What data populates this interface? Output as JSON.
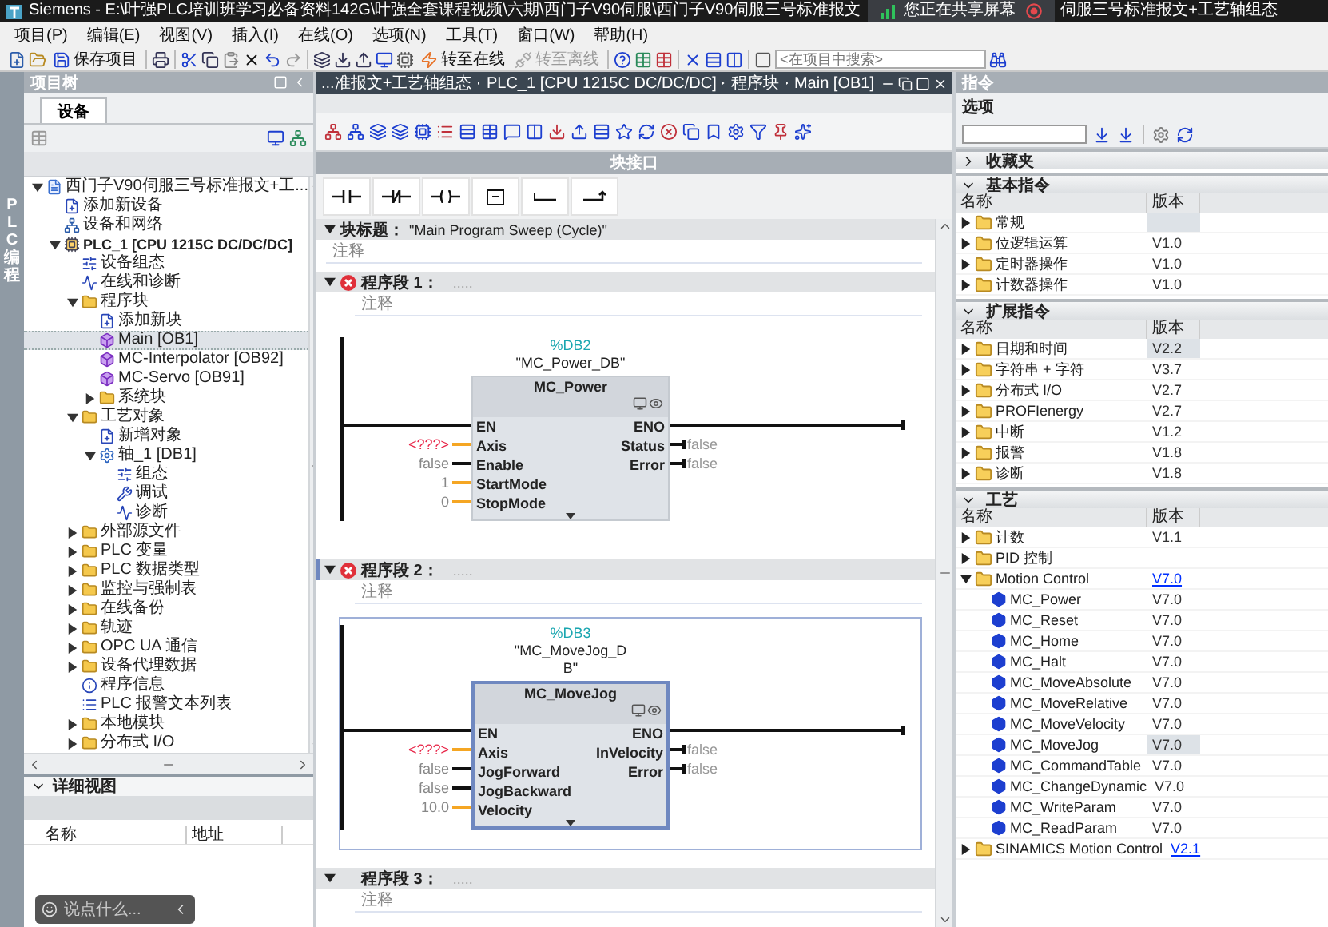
{
  "title_bar": {
    "title": "Siemens  -  E:\\叶强PLC培训班学习必备资料142G\\叶强全套课程视频\\六期\\西门子V90伺服\\西门子V90伺服三号标准报文",
    "sharing": "您正在共享屏幕",
    "title_tail": "伺服三号标准报文+工艺轴组态"
  },
  "menu": [
    "项目(P)",
    "编辑(E)",
    "视图(V)",
    "插入(I)",
    "在线(O)",
    "选项(N)",
    "工具(T)",
    "窗口(W)",
    "帮助(H)"
  ],
  "toolbar": {
    "save": "保存项目",
    "go_online": {
      "label": "转至在线",
      "disabled": false
    },
    "go_offline": {
      "label": "转至离线",
      "disabled": true
    },
    "search": {
      "placeholder": "<在项目中搜索>"
    }
  },
  "side_tab": "PLC 编程",
  "project_tree": {
    "title": "项目树",
    "tabs": [
      {
        "label": "设备",
        "selected": true
      }
    ],
    "items": [
      {
        "label": "西门子V90伺服三号标准报文+工...",
        "kind": "project",
        "expanded": true,
        "selected": false,
        "children": [
          {
            "label": "添加新设备",
            "kind": "add",
            "selected": false
          },
          {
            "label": "设备和网络",
            "kind": "network",
            "selected": false
          },
          {
            "label": "PLC_1 [CPU 1215C DC/DC/DC]",
            "kind": "plc",
            "expanded": true,
            "selected": false,
            "children": [
              {
                "label": "设备组态",
                "kind": "config",
                "selected": false
              },
              {
                "label": "在线和诊断",
                "kind": "diag",
                "selected": false
              },
              {
                "label": "程序块",
                "kind": "folder",
                "expanded": true,
                "selected": false,
                "children": [
                  {
                    "label": "添加新块",
                    "kind": "add",
                    "selected": false
                  },
                  {
                    "label": "Main [OB1]",
                    "kind": "block",
                    "selected": true
                  },
                  {
                    "label": "MC-Interpolator [OB92]",
                    "kind": "block",
                    "selected": false
                  },
                  {
                    "label": "MC-Servo [OB91]",
                    "kind": "block",
                    "selected": false
                  },
                  {
                    "label": "系统块",
                    "kind": "folder",
                    "expanded": false,
                    "selected": false
                  }
                ]
              },
              {
                "label": "工艺对象",
                "kind": "folder",
                "expanded": true,
                "selected": false,
                "children": [
                  {
                    "label": "新增对象",
                    "kind": "add",
                    "selected": false
                  },
                  {
                    "label": "轴_1 [DB1]",
                    "kind": "axis",
                    "expanded": true,
                    "selected": false,
                    "children": [
                      {
                        "label": "组态",
                        "kind": "config",
                        "selected": false
                      },
                      {
                        "label": "调试",
                        "kind": "tool",
                        "selected": false
                      },
                      {
                        "label": "诊断",
                        "kind": "diag",
                        "selected": false
                      }
                    ]
                  }
                ]
              },
              {
                "label": "外部源文件",
                "kind": "folder",
                "expanded": false,
                "selected": false
              },
              {
                "label": "PLC 变量",
                "kind": "folder",
                "expanded": false,
                "selected": false
              },
              {
                "label": "PLC 数据类型",
                "kind": "folder",
                "expanded": false,
                "selected": false
              },
              {
                "label": "监控与强制表",
                "kind": "folder",
                "expanded": false,
                "selected": false
              },
              {
                "label": "在线备份",
                "kind": "folder",
                "expanded": false,
                "selected": false
              },
              {
                "label": "轨迹",
                "kind": "folder",
                "expanded": false,
                "selected": false
              },
              {
                "label": "OPC UA 通信",
                "kind": "folder",
                "expanded": false,
                "selected": false
              },
              {
                "label": "设备代理数据",
                "kind": "folder",
                "expanded": false,
                "selected": false
              },
              {
                "label": "程序信息",
                "kind": "info",
                "selected": false
              },
              {
                "label": "PLC 报警文本列表",
                "kind": "list",
                "selected": false
              },
              {
                "label": "本地模块",
                "kind": "folder",
                "expanded": false,
                "selected": false
              },
              {
                "label": "分布式 I/O",
                "kind": "folder",
                "expanded": false,
                "selected": false
              }
            ]
          }
        ]
      }
    ]
  },
  "detail_view": {
    "title": "详细视图",
    "columns": [
      "名称",
      "地址"
    ]
  },
  "chat_overlay": {
    "placeholder": "说点什么..."
  },
  "editor": {
    "breadcrumb": [
      "...准报文+工艺轴组态",
      "PLC_1 [CPU 1215C DC/DC/DC]",
      "程序块",
      "Main [OB1]"
    ],
    "block_interface": "块接口",
    "block_title": {
      "label": "块标题：",
      "value": "\"Main Program Sweep (Cycle)\"",
      "comment": "注释"
    },
    "networks": [
      {
        "title": "程序段 1：",
        "dots": ".....",
        "expanded": true,
        "error": true,
        "selected": false,
        "comment": "注释",
        "block": {
          "db": "%DB2",
          "instance": "\"MC_Power_DB\"",
          "name": "MC_Power",
          "en": "EN",
          "eno": "ENO",
          "inputs": [
            {
              "name": "Axis",
              "value": "<???>",
              "kind": "error"
            },
            {
              "name": "Enable",
              "value": "false",
              "kind": "bool"
            },
            {
              "name": "StartMode",
              "value": "1",
              "kind": "number"
            },
            {
              "name": "StopMode",
              "value": "0",
              "kind": "number"
            }
          ],
          "outputs": [
            {
              "name": "Status",
              "value": "false"
            },
            {
              "name": "Error",
              "value": "false"
            }
          ]
        }
      },
      {
        "title": "程序段 2：",
        "dots": ".....",
        "expanded": true,
        "error": true,
        "selected": true,
        "comment": "注释",
        "block": {
          "db": "%DB3",
          "instance": "\"MC_MoveJog_DB\"",
          "name": "MC_MoveJog",
          "en": "EN",
          "eno": "ENO",
          "inputs": [
            {
              "name": "Axis",
              "value": "<???>",
              "kind": "error"
            },
            {
              "name": "JogForward",
              "value": "false",
              "kind": "bool"
            },
            {
              "name": "JogBackward",
              "value": "false",
              "kind": "bool"
            },
            {
              "name": "Velocity",
              "value": "10.0",
              "kind": "number"
            }
          ],
          "outputs": [
            {
              "name": "InVelocity",
              "value": "false"
            },
            {
              "name": "Error",
              "value": "false"
            }
          ]
        }
      },
      {
        "title": "程序段 3：",
        "dots": ".....",
        "expanded": true,
        "error": false,
        "selected": false,
        "comment": "注释"
      }
    ]
  },
  "instructions": {
    "title": "指令",
    "options": "选项",
    "sections": [
      {
        "title": "收藏夹",
        "expanded": false
      },
      {
        "title": "基本指令",
        "expanded": true,
        "columns": [
          "名称",
          "版本"
        ],
        "rows": [
          {
            "name": "常规",
            "kind": "folder",
            "expanded": false,
            "selected": true
          },
          {
            "name": "位逻辑运算",
            "version": "V1.0",
            "kind": "folder",
            "expanded": false,
            "selected": false,
            "link": false
          },
          {
            "name": "定时器操作",
            "version": "V1.0",
            "kind": "folder",
            "expanded": false,
            "selected": false,
            "link": false
          },
          {
            "name": "计数器操作",
            "version": "V1.0",
            "kind": "folder",
            "expanded": false,
            "selected": false,
            "link": false
          }
        ]
      },
      {
        "title": "扩展指令",
        "expanded": true,
        "columns": [
          "名称",
          "版本"
        ],
        "rows": [
          {
            "name": "日期和时间",
            "version": "V2.2",
            "kind": "folder",
            "expanded": false,
            "selected": true,
            "link": false
          },
          {
            "name": "字符串 + 字符",
            "version": "V3.7",
            "kind": "folder",
            "expanded": false,
            "selected": false,
            "link": false
          },
          {
            "name": "分布式 I/O",
            "version": "V2.7",
            "kind": "folder",
            "expanded": false,
            "selected": false,
            "link": false
          },
          {
            "name": "PROFIenergy",
            "version": "V2.7",
            "kind": "folder",
            "expanded": false,
            "selected": false,
            "link": false
          },
          {
            "name": "中断",
            "version": "V1.2",
            "kind": "folder",
            "expanded": false,
            "selected": false,
            "link": false
          },
          {
            "name": "报警",
            "version": "V1.8",
            "kind": "folder",
            "expanded": false,
            "selected": false,
            "link": false
          },
          {
            "name": "诊断",
            "version": "V1.8",
            "kind": "folder",
            "expanded": false,
            "selected": false,
            "link": false
          }
        ]
      },
      {
        "title": "工艺",
        "expanded": true,
        "columns": [
          "名称",
          "版本"
        ],
        "rows": [
          {
            "name": "计数",
            "version": "V1.1",
            "kind": "folder",
            "expanded": false,
            "selected": false,
            "link": false
          },
          {
            "name": "PID 控制",
            "kind": "folder",
            "expanded": false,
            "selected": false
          },
          {
            "name": "Motion Control",
            "version": "V7.0",
            "kind": "folder",
            "expanded": true,
            "selected": false,
            "link": true,
            "children": [
              {
                "name": "MC_Power",
                "version": "V7.0",
                "kind": "block",
                "selected": false,
                "link": false
              },
              {
                "name": "MC_Reset",
                "version": "V7.0",
                "kind": "block",
                "selected": false,
                "link": false
              },
              {
                "name": "MC_Home",
                "version": "V7.0",
                "kind": "block",
                "selected": false,
                "link": false
              },
              {
                "name": "MC_Halt",
                "version": "V7.0",
                "kind": "block",
                "selected": false,
                "link": false
              },
              {
                "name": "MC_MoveAbsolute",
                "version": "V7.0",
                "kind": "block",
                "selected": false,
                "link": false
              },
              {
                "name": "MC_MoveRelative",
                "version": "V7.0",
                "kind": "block",
                "selected": false,
                "link": false
              },
              {
                "name": "MC_MoveVelocity",
                "version": "V7.0",
                "kind": "block",
                "selected": false,
                "link": false
              },
              {
                "name": "MC_MoveJog",
                "version": "V7.0",
                "kind": "block",
                "selected": true,
                "link": false
              },
              {
                "name": "MC_CommandTable",
                "version": "V7.0",
                "kind": "block",
                "selected": false,
                "link": false
              },
              {
                "name": "MC_ChangeDynamic",
                "version": "V7.0",
                "kind": "block",
                "selected": false,
                "link": false
              },
              {
                "name": "MC_WriteParam",
                "version": "V7.0",
                "kind": "block",
                "selected": false,
                "link": false
              },
              {
                "name": "MC_ReadParam",
                "version": "V7.0",
                "kind": "block",
                "selected": false,
                "link": false
              }
            ]
          },
          {
            "name": "SINAMICS Motion Control",
            "version": "V2.1",
            "kind": "folder",
            "expanded": false,
            "selected": false,
            "link": true
          }
        ]
      }
    ]
  }
}
